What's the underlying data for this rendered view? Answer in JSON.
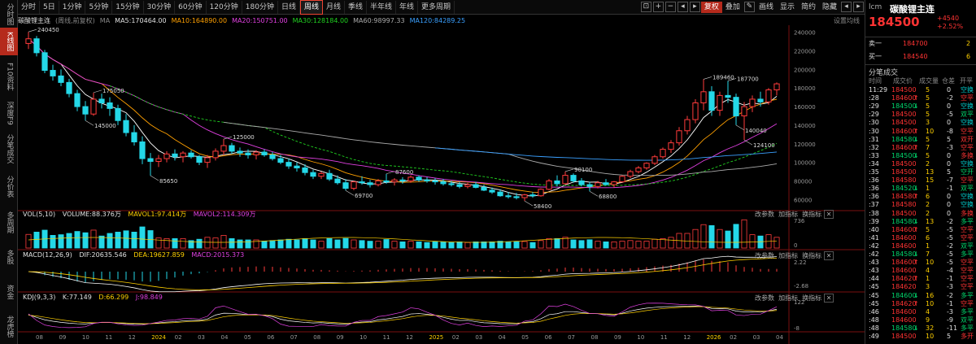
{
  "left_tabs": [
    {
      "label": "分时图",
      "active": false
    },
    {
      "label": "K线图",
      "active": true
    },
    {
      "label": "F10资料",
      "active": false
    },
    {
      "label": "深度F9",
      "active": false
    },
    {
      "label": "分笔成交",
      "active": false
    },
    {
      "label": "分价表",
      "active": false
    },
    {
      "label": "多周期",
      "active": false
    },
    {
      "label": "多股",
      "active": false
    },
    {
      "label": "资金",
      "active": false
    },
    {
      "label": "龙虎榜",
      "active": false
    }
  ],
  "periods": [
    "分时",
    "5日",
    "1分钟",
    "5分钟",
    "15分钟",
    "30分钟",
    "60分钟",
    "120分钟",
    "180分钟",
    "日线",
    "周线",
    "月线",
    "季线",
    "半年线",
    "年线",
    "更多周期"
  ],
  "active_period": "周线",
  "toolbar_right": {
    "fuquan": "复权",
    "diejia": "叠加",
    "huaxian": "画线",
    "xianshi": "显示",
    "jianyue": "简约",
    "yincang": "隐藏",
    "icons": [
      "⊡",
      "+",
      "−",
      "◂",
      "▸"
    ],
    "win_icons": [
      "◂",
      "▸"
    ]
  },
  "ma_line": {
    "name": "碳酸锂主连",
    "mode": "(周线,前复权)",
    "ma": "MA",
    "ma5": "MA5:170464.00",
    "ma10": "MA10:164890.00",
    "ma20": "MA20:150751.00",
    "ma30": "MA30:128184.00",
    "ma60": "MA60:98997.33",
    "ma120": "MA120:84289.25",
    "setting": "设置均线"
  },
  "y_axis_main": [
    "240000",
    "220000",
    "200000",
    "180000",
    "160000",
    "140000",
    "120000",
    "100000",
    "80000",
    "60000"
  ],
  "annotations": [
    {
      "text": "240450"
    },
    {
      "text": "175050"
    },
    {
      "text": "145000"
    },
    {
      "text": "125000"
    },
    {
      "text": "85650"
    },
    {
      "text": "87600"
    },
    {
      "text": "69700"
    },
    {
      "text": "90100"
    },
    {
      "text": "68800"
    },
    {
      "text": "58400"
    },
    {
      "text": "189460"
    },
    {
      "text": "187700"
    },
    {
      "text": "140040"
    },
    {
      "text": "124100"
    }
  ],
  "vol": {
    "head": "VOL(5,10)",
    "volume": "VOLUME:88.376万",
    "mavol1": "MAVOL1:97.414万",
    "mavol2": "MAVOL2:114.309万",
    "ytop": "736",
    "ybot": "0"
  },
  "macd": {
    "head": "MACD(12,26,9)",
    "dif": "DIF:20635.546",
    "dea": "DEA:19627.859",
    "macd": "MACD:2015.373",
    "ytop": "2.22",
    "ybot": "-2.68"
  },
  "kdj": {
    "head": "KDJ(9,3,3)",
    "k": "K:77.149",
    "d": "D:66.299",
    "j": "J:98.849",
    "ytop": "122",
    "ybot": "-8"
  },
  "sub_actions": [
    "改参数",
    "加指标",
    "换指标"
  ],
  "x_axis": [
    "08",
    "09",
    "10",
    "11",
    "12",
    "2024",
    "02",
    "03",
    "04",
    "05",
    "06",
    "07",
    "08",
    "09",
    "10",
    "11",
    "12",
    "2025",
    "02",
    "03",
    "04",
    "05",
    "06",
    "07",
    "08",
    "09",
    "10",
    "11",
    "12",
    "2026",
    "02",
    "03",
    "04"
  ],
  "quote": {
    "code": "lcm",
    "name": "碳酸锂主连",
    "price": "184500",
    "change": "+4540",
    "pct": "+2.52%",
    "sell1_label": "卖一",
    "sell1_price": "184700",
    "sell1_vol": "2",
    "buy1_label": "买一",
    "buy1_price": "184540",
    "buy1_vol": "6"
  },
  "trades_title": "分笔成交",
  "trades_header": [
    "时间",
    "成交价",
    "成交量",
    "仓差",
    "开平"
  ],
  "trades": [
    {
      "t": "11:29",
      "p": "184500",
      "a": "",
      "v": "5",
      "d": "0",
      "k": "空换",
      "c": "cyan"
    },
    {
      "t": ":28",
      "p": "184600",
      "a": "↑",
      "v": "5",
      "d": "-2",
      "k": "空平",
      "c": "red"
    },
    {
      "t": ":29",
      "p": "184500",
      "a": "↓",
      "v": "5",
      "d": "0",
      "k": "空换",
      "c": "cyan"
    },
    {
      "t": ":29",
      "p": "184500",
      "a": "",
      "v": "5",
      "d": "-5",
      "k": "双平",
      "c": "green"
    },
    {
      "t": ":30",
      "p": "184500",
      "a": "",
      "v": "3",
      "d": "0",
      "k": "空换",
      "c": "cyan"
    },
    {
      "t": ":30",
      "p": "184600",
      "a": "↑",
      "v": "10",
      "d": "-8",
      "k": "空平",
      "c": "red"
    },
    {
      "t": ":31",
      "p": "184580",
      "a": "↓",
      "v": "5",
      "d": "5",
      "k": "双开",
      "c": "red"
    },
    {
      "t": ":32",
      "p": "184600",
      "a": "↑",
      "v": "7",
      "d": "-3",
      "k": "空平",
      "c": "red"
    },
    {
      "t": ":33",
      "p": "184500",
      "a": "↓",
      "v": "5",
      "d": "0",
      "k": "多换",
      "c": "red"
    },
    {
      "t": ":34",
      "p": "184500",
      "a": "",
      "v": "2",
      "d": "0",
      "k": "空换",
      "c": "cyan"
    },
    {
      "t": ":35",
      "p": "184500",
      "a": "",
      "v": "13",
      "d": "5",
      "k": "空开",
      "c": "green"
    },
    {
      "t": ":36",
      "p": "184580",
      "a": "",
      "v": "15",
      "d": "-7",
      "k": "空平",
      "c": "red"
    },
    {
      "t": ":36",
      "p": "184520",
      "a": "↓",
      "v": "1",
      "d": "-1",
      "k": "双平",
      "c": "green"
    },
    {
      "t": ":36",
      "p": "184580",
      "a": "↑",
      "v": "6",
      "d": "0",
      "k": "空换",
      "c": "cyan"
    },
    {
      "t": ":37",
      "p": "184580",
      "a": "",
      "v": "2",
      "d": "0",
      "k": "空换",
      "c": "cyan"
    },
    {
      "t": ":38",
      "p": "184500",
      "a": "",
      "v": "2",
      "d": "0",
      "k": "多换",
      "c": "red"
    },
    {
      "t": ":39",
      "p": "184580",
      "a": "↓",
      "v": "13",
      "d": "-2",
      "k": "多平",
      "c": "green"
    },
    {
      "t": ":40",
      "p": "184600",
      "a": "↑",
      "v": "5",
      "d": "-5",
      "k": "空平",
      "c": "red"
    },
    {
      "t": ":41",
      "p": "184600",
      "a": "",
      "v": "6",
      "d": "-5",
      "k": "空平",
      "c": "red"
    },
    {
      "t": ":42",
      "p": "184600",
      "a": "",
      "v": "1",
      "d": "-2",
      "k": "双平",
      "c": "green"
    },
    {
      "t": ":42",
      "p": "184580",
      "a": "↓",
      "v": "7",
      "d": "-5",
      "k": "多平",
      "c": "green"
    },
    {
      "t": ":43",
      "p": "184600",
      "a": "↑",
      "v": "10",
      "d": "-5",
      "k": "空平",
      "c": "red"
    },
    {
      "t": ":43",
      "p": "184600",
      "a": "",
      "v": "4",
      "d": "-4",
      "k": "空平",
      "c": "red"
    },
    {
      "t": ":44",
      "p": "184620",
      "a": "↑",
      "v": "1",
      "d": "-1",
      "k": "空平",
      "c": "red"
    },
    {
      "t": ":45",
      "p": "184620",
      "a": "",
      "v": "3",
      "d": "-3",
      "k": "空平",
      "c": "red"
    },
    {
      "t": ":45",
      "p": "184600",
      "a": "↓",
      "v": "16",
      "d": "-2",
      "k": "多平",
      "c": "green"
    },
    {
      "t": ":45",
      "p": "184620",
      "a": "↑",
      "v": "10",
      "d": "-1",
      "k": "空平",
      "c": "red"
    },
    {
      "t": ":46",
      "p": "184600",
      "a": "",
      "v": "4",
      "d": "-3",
      "k": "多平",
      "c": "green"
    },
    {
      "t": ":48",
      "p": "184600",
      "a": "",
      "v": "9",
      "d": "-9",
      "k": "双平",
      "c": "green"
    },
    {
      "t": ":48",
      "p": "184580",
      "a": "↓",
      "v": "32",
      "d": "-11",
      "k": "多平",
      "c": "green"
    },
    {
      "t": ":49",
      "p": "184500",
      "a": "",
      "v": "10",
      "d": "5",
      "k": "多开",
      "c": "red"
    }
  ],
  "chart_data": {
    "type": "candlestick",
    "period": "weekly",
    "ylim": [
      55000,
      245000
    ],
    "candles": [
      [
        228000,
        240450,
        222000,
        233000
      ],
      [
        233000,
        236000,
        214000,
        218000
      ],
      [
        218000,
        221000,
        196000,
        199000
      ],
      [
        199000,
        205000,
        188000,
        193000
      ],
      [
        193000,
        200000,
        182000,
        186000
      ],
      [
        186000,
        190000,
        170000,
        174000
      ],
      [
        174000,
        178000,
        155000,
        160000
      ],
      [
        160000,
        166000,
        145000,
        152000
      ],
      [
        152000,
        175050,
        150000,
        168000
      ],
      [
        168000,
        174000,
        158000,
        164000
      ],
      [
        164000,
        170000,
        150000,
        158000
      ],
      [
        158000,
        162000,
        140000,
        145000
      ],
      [
        145000,
        152000,
        128000,
        132000
      ],
      [
        132000,
        140000,
        118000,
        122000
      ],
      [
        122000,
        128000,
        98000,
        104000
      ],
      [
        104000,
        110000,
        85650,
        101000
      ],
      [
        101000,
        108000,
        95000,
        104000
      ],
      [
        104000,
        112000,
        100000,
        109000
      ],
      [
        109000,
        114000,
        102000,
        106000
      ],
      [
        106000,
        112000,
        100000,
        110000
      ],
      [
        110000,
        113000,
        104000,
        106000
      ],
      [
        106000,
        108000,
        97000,
        100000
      ],
      [
        100000,
        108000,
        94000,
        105000
      ],
      [
        105000,
        115000,
        102000,
        112000
      ],
      [
        112000,
        125000,
        108000,
        118000
      ],
      [
        118000,
        121000,
        109000,
        112000
      ],
      [
        112000,
        116000,
        106000,
        110000
      ],
      [
        110000,
        114000,
        104000,
        108000
      ],
      [
        108000,
        113000,
        103000,
        111000
      ],
      [
        111000,
        114000,
        106000,
        108000
      ],
      [
        108000,
        111000,
        102000,
        104000
      ],
      [
        104000,
        108000,
        98000,
        100000
      ],
      [
        100000,
        104000,
        93000,
        96000
      ],
      [
        96000,
        100000,
        90000,
        94000
      ],
      [
        94000,
        98000,
        86000,
        89000
      ],
      [
        89000,
        92000,
        82000,
        85000
      ],
      [
        85000,
        90000,
        82000,
        88000
      ],
      [
        88000,
        92000,
        80000,
        82000
      ],
      [
        82000,
        86000,
        76000,
        78000
      ],
      [
        78000,
        82000,
        69700,
        72000
      ],
      [
        72000,
        80000,
        70000,
        79000
      ],
      [
        79000,
        85000,
        76000,
        78000
      ],
      [
        78000,
        81000,
        73000,
        76000
      ],
      [
        76000,
        82000,
        74000,
        80000
      ],
      [
        80000,
        87600,
        77000,
        79000
      ],
      [
        79000,
        83000,
        75000,
        81000
      ],
      [
        81000,
        84000,
        77000,
        80000
      ],
      [
        80000,
        86000,
        78000,
        84000
      ],
      [
        84000,
        86000,
        79000,
        81000
      ],
      [
        81000,
        84000,
        78000,
        80000
      ],
      [
        80000,
        83000,
        76000,
        79000
      ],
      [
        79000,
        82000,
        75000,
        77000
      ],
      [
        77000,
        80000,
        74000,
        76000
      ],
      [
        76000,
        79000,
        72000,
        74000
      ],
      [
        74000,
        78000,
        72000,
        76000
      ],
      [
        76000,
        79000,
        72000,
        73000
      ],
      [
        73000,
        76000,
        69000,
        70000
      ],
      [
        70000,
        73000,
        66000,
        68000
      ],
      [
        68000,
        71000,
        63000,
        64000
      ],
      [
        64000,
        68000,
        61000,
        63000
      ],
      [
        63000,
        67000,
        60000,
        62000
      ],
      [
        62000,
        66000,
        58400,
        65000
      ],
      [
        65000,
        68000,
        62000,
        64000
      ],
      [
        64000,
        72000,
        63000,
        71000
      ],
      [
        71000,
        82000,
        70000,
        80000
      ],
      [
        80000,
        86000,
        74000,
        77000
      ],
      [
        77000,
        90100,
        76000,
        86000
      ],
      [
        86000,
        88000,
        78000,
        80000
      ],
      [
        80000,
        83000,
        74000,
        76000
      ],
      [
        76000,
        79000,
        68800,
        74000
      ],
      [
        74000,
        80000,
        72000,
        78000
      ],
      [
        78000,
        82000,
        75000,
        76000
      ],
      [
        76000,
        80000,
        73000,
        79000
      ],
      [
        79000,
        86000,
        78000,
        85000
      ],
      [
        85000,
        92000,
        83000,
        90000
      ],
      [
        90000,
        96000,
        88000,
        94000
      ],
      [
        94000,
        100000,
        92000,
        99000
      ],
      [
        99000,
        108000,
        97000,
        106000
      ],
      [
        106000,
        116000,
        104000,
        114000
      ],
      [
        114000,
        124000,
        110000,
        121000
      ],
      [
        121000,
        138000,
        118000,
        134000
      ],
      [
        134000,
        150000,
        130000,
        146000
      ],
      [
        146000,
        168000,
        142000,
        164000
      ],
      [
        164000,
        189460,
        156000,
        176000
      ],
      [
        176000,
        182000,
        150000,
        156000
      ],
      [
        156000,
        176000,
        150000,
        172000
      ],
      [
        172000,
        187700,
        164000,
        170000
      ],
      [
        170000,
        174000,
        140040,
        150000
      ],
      [
        150000,
        165000,
        124100,
        160000
      ],
      [
        160000,
        172000,
        154000,
        168000
      ],
      [
        168000,
        176000,
        160000,
        165000
      ],
      [
        165000,
        180000,
        162000,
        178000
      ],
      [
        178000,
        186000,
        172000,
        184500
      ]
    ]
  }
}
